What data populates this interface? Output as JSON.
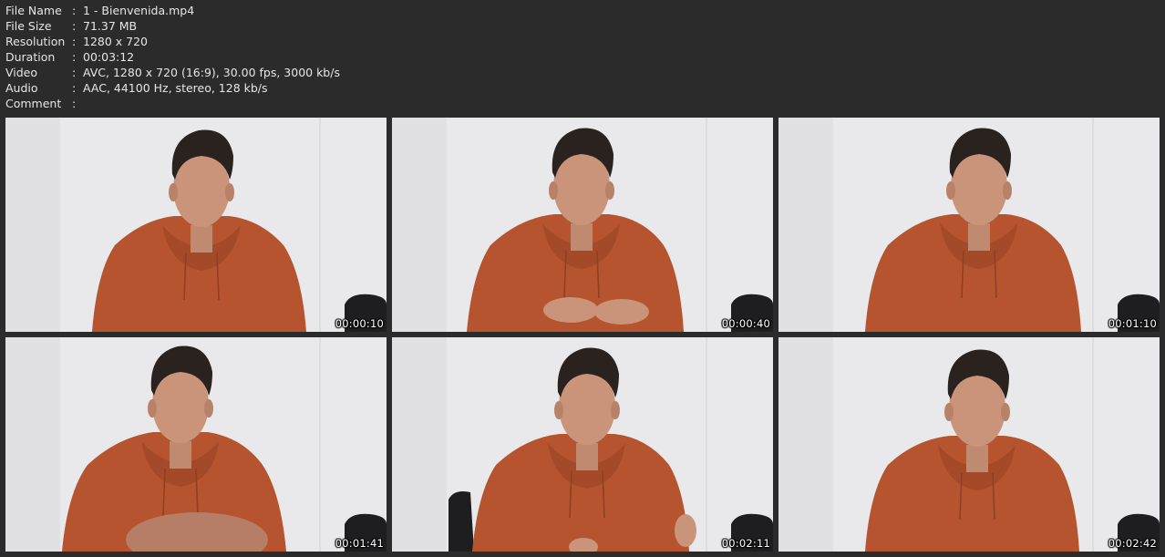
{
  "info": {
    "rows": [
      {
        "label": "File Name",
        "sep": ":",
        "value": "1 - Bienvenida.mp4"
      },
      {
        "label": "File Size",
        "sep": ":",
        "value": "71.37 MB"
      },
      {
        "label": "Resolution",
        "sep": ":",
        "value": "1280 x 720"
      },
      {
        "label": "Duration",
        "sep": ":",
        "value": "00:03:12"
      },
      {
        "label": "Video",
        "sep": ":",
        "value": "AVC, 1280 x 720 (16:9), 30.00 fps, 3000 kb/s"
      },
      {
        "label": "Audio",
        "sep": ":",
        "value": "AAC, 44100 Hz, stereo, 128 kb/s"
      },
      {
        "label": "Comment",
        "sep": ":",
        "value": ""
      }
    ]
  },
  "thumbnails": [
    {
      "timestamp": "00:00:10"
    },
    {
      "timestamp": "00:00:40"
    },
    {
      "timestamp": "00:01:10"
    },
    {
      "timestamp": "00:01:41"
    },
    {
      "timestamp": "00:02:11"
    },
    {
      "timestamp": "00:02:42"
    }
  ],
  "colors": {
    "background": "#2b2b2b",
    "text": "#e6e6e6",
    "wall": "#e9e9eb",
    "hoodie": "#b5542e",
    "hair": "#2a221e",
    "skin": "#c99479",
    "chair": "#1e1e20"
  }
}
